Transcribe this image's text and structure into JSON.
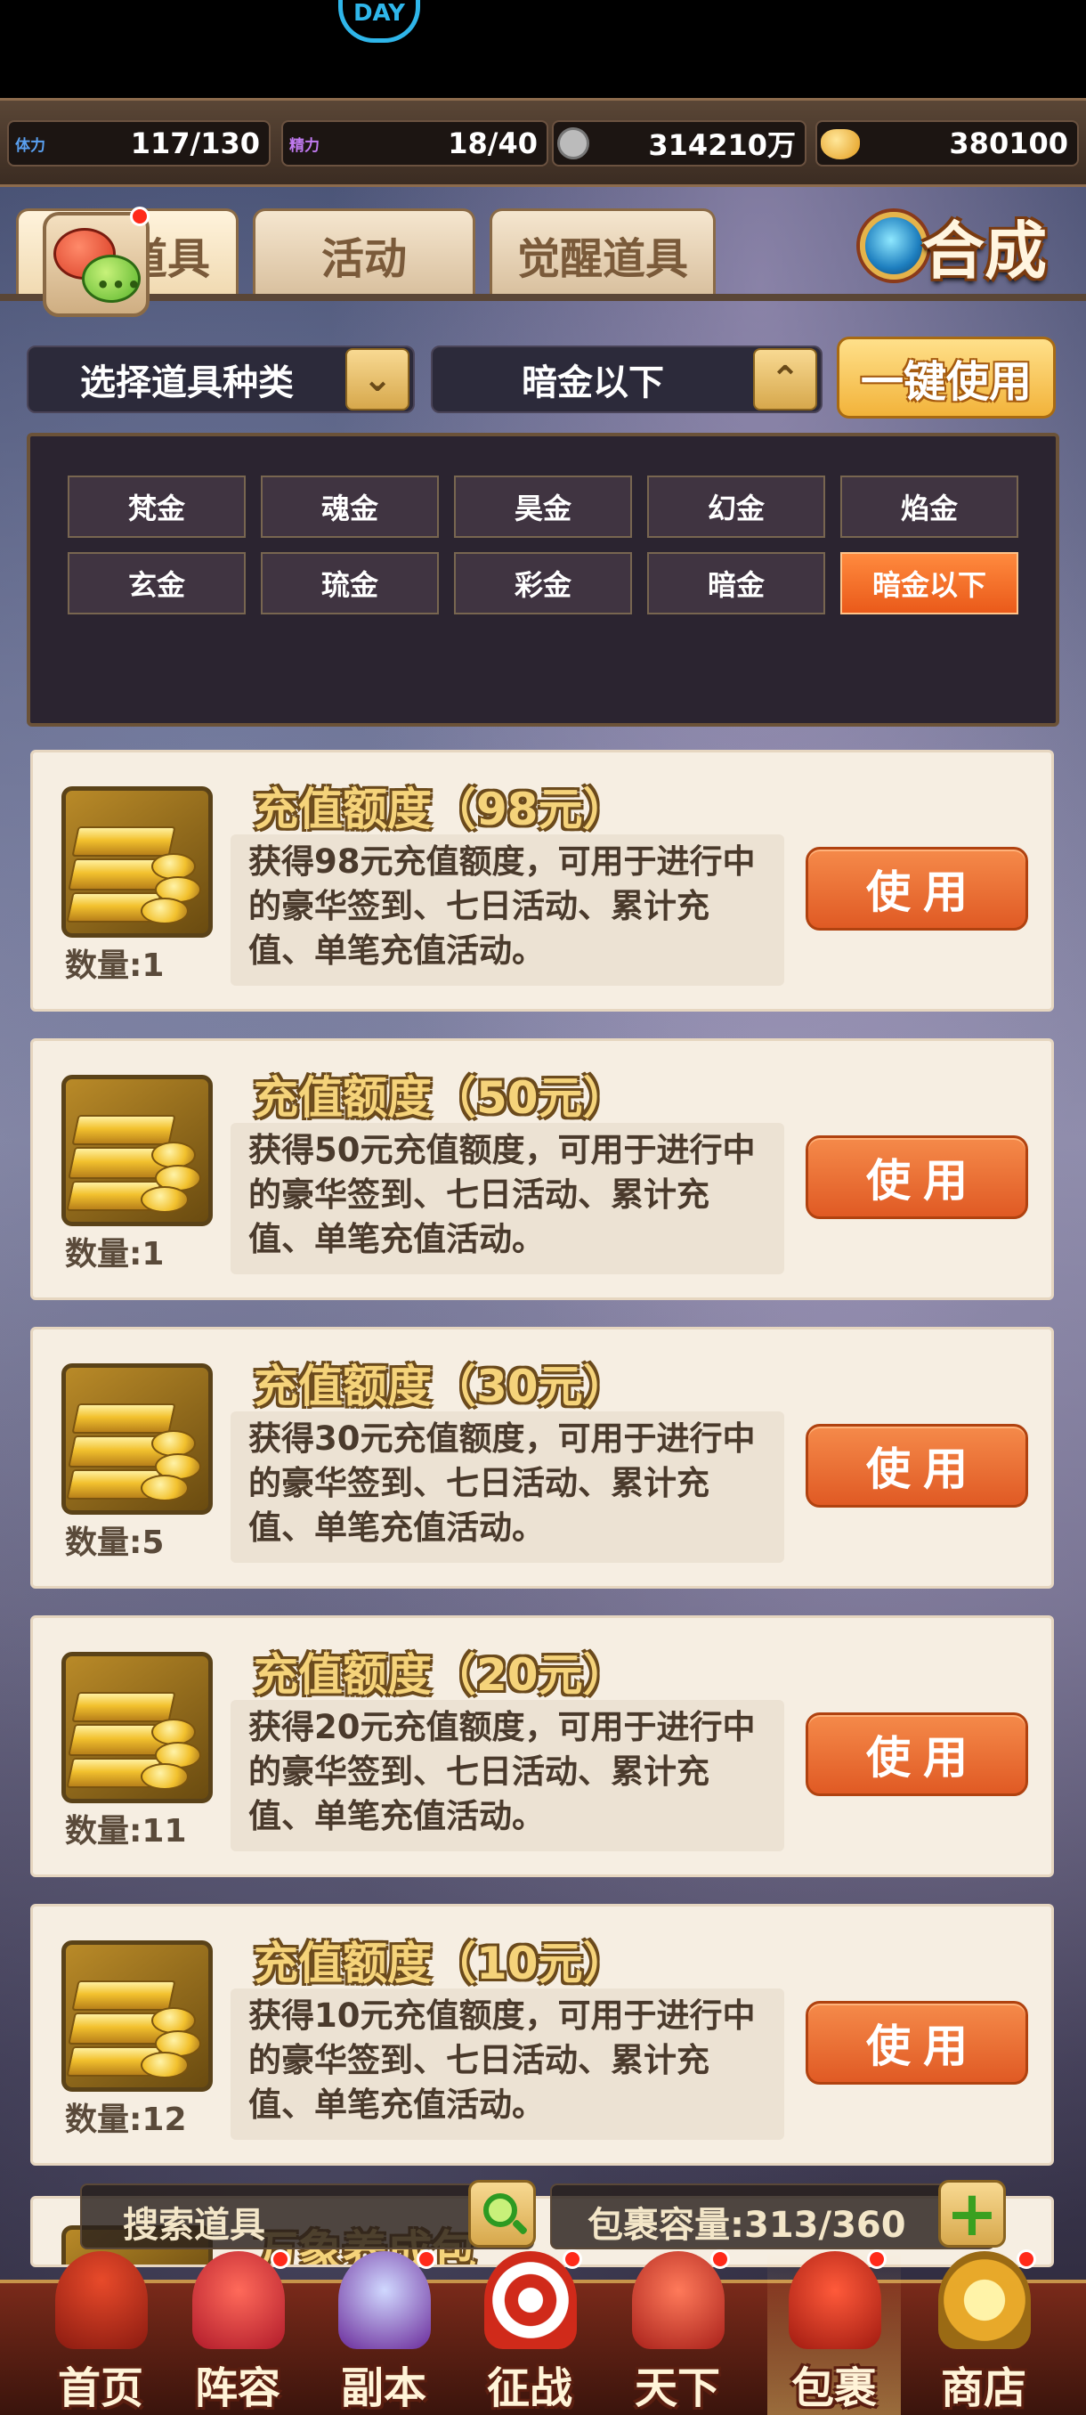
{
  "resources": [
    {
      "icon": "stamina-icon",
      "icon_text": "体力",
      "value": "117/130",
      "color": "#5aa0f0"
    },
    {
      "icon": "energy-icon",
      "icon_text": "精力",
      "value": "18/40",
      "color": "#a05ae0"
    },
    {
      "icon": "copper-coin-icon",
      "icon_text": "",
      "value": "314210万",
      "color": "#c8c8c8"
    },
    {
      "icon": "gold-ingot-icon",
      "icon_text": "",
      "value": "380100",
      "color": "#f2b33a"
    }
  ],
  "tabs": [
    {
      "label": "道具",
      "active": true
    },
    {
      "label": "活动",
      "active": false
    },
    {
      "label": "觉醒道具",
      "active": false
    }
  ],
  "synth_label": "合成",
  "filters": {
    "type_label": "选择道具种类",
    "grade_label": "暗金以下",
    "use_all_label": "一键使用",
    "chips": [
      "梵金",
      "魂金",
      "昊金",
      "幻金",
      "焰金",
      "玄金",
      "琉金",
      "彩金",
      "暗金",
      "暗金以下"
    ],
    "active_chip": "暗金以下"
  },
  "items": [
    {
      "title": "充值额度（98元）",
      "desc": "获得98元充值额度，可用于进行中的豪华签到、七日活动、累计充值、单笔充值活动。",
      "qty": "数量:1",
      "button": "使用"
    },
    {
      "title": "充值额度（50元）",
      "desc": "获得50元充值额度，可用于进行中的豪华签到、七日活动、累计充值、单笔充值活动。",
      "qty": "数量:1",
      "button": "使用"
    },
    {
      "title": "充值额度（30元）",
      "desc": "获得30元充值额度，可用于进行中的豪华签到、七日活动、累计充值、单笔充值活动。",
      "qty": "数量:5",
      "button": "使用"
    },
    {
      "title": "充值额度（20元）",
      "desc": "获得20元充值额度，可用于进行中的豪华签到、七日活动、累计充值、单笔充值活动。",
      "qty": "数量:11",
      "button": "使用"
    },
    {
      "title": "充值额度（10元）",
      "desc": "获得10元充值额度，可用于进行中的豪华签到、七日活动、累计充值、单笔充值活动。",
      "qty": "数量:12",
      "button": "使用"
    }
  ],
  "partial_item_title": "万象养成包",
  "search_placeholder": "搜索道具",
  "capacity_text": "包裹容量:313/360",
  "nav": [
    {
      "label": "首页",
      "icon": "palace-icon",
      "dot": false,
      "active": false
    },
    {
      "label": "阵容",
      "icon": "lineup-icon",
      "dot": true,
      "active": false
    },
    {
      "label": "副本",
      "icon": "dungeon-icon",
      "dot": true,
      "active": false
    },
    {
      "label": "征战",
      "icon": "target-icon",
      "dot": true,
      "active": false
    },
    {
      "label": "天下",
      "icon": "world-icon",
      "dot": true,
      "active": false
    },
    {
      "label": "包裹",
      "icon": "bag-icon",
      "dot": true,
      "active": true
    },
    {
      "label": "商店",
      "icon": "shop-icon",
      "dot": true,
      "active": false
    }
  ]
}
